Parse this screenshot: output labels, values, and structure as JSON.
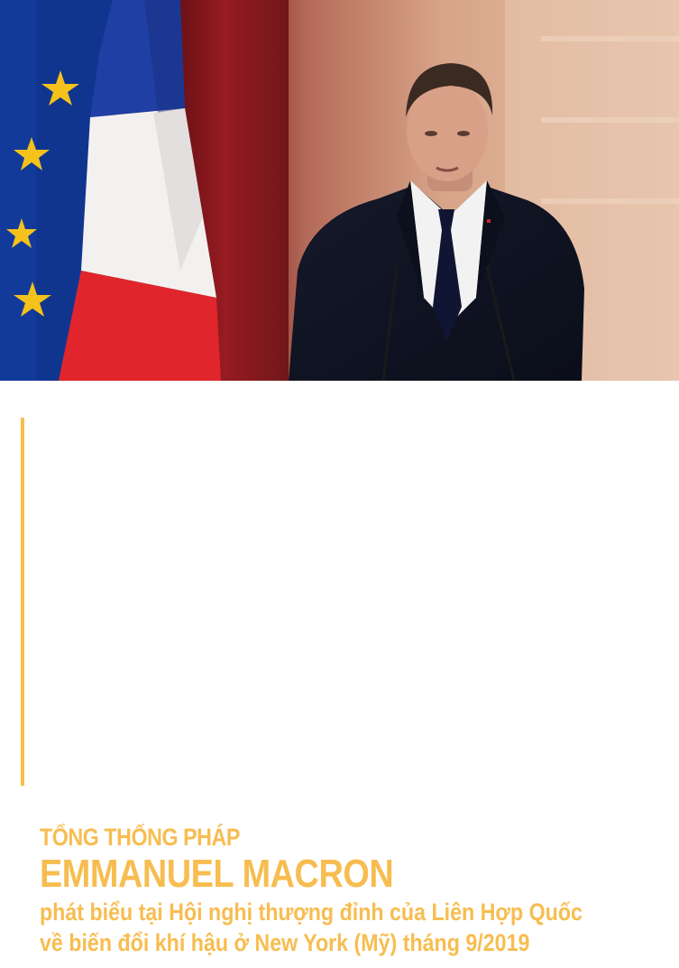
{
  "photo": {
    "subject": "man-speaking-at-podium",
    "flags": [
      "eu-flag",
      "france-flag"
    ]
  },
  "caption": {
    "kicker": "TỔNG THỐNG PHÁP",
    "name": "EMMANUEL MACRON",
    "desc_line1": "phát biểu tại Hội nghị thượng đỉnh của Liên Hợp Quốc",
    "desc_line2": "về biến đổi khí hậu ở New York (Mỹ) tháng 9/2019"
  },
  "colors": {
    "accent": "#f7bd50",
    "background": "#ffffff"
  }
}
